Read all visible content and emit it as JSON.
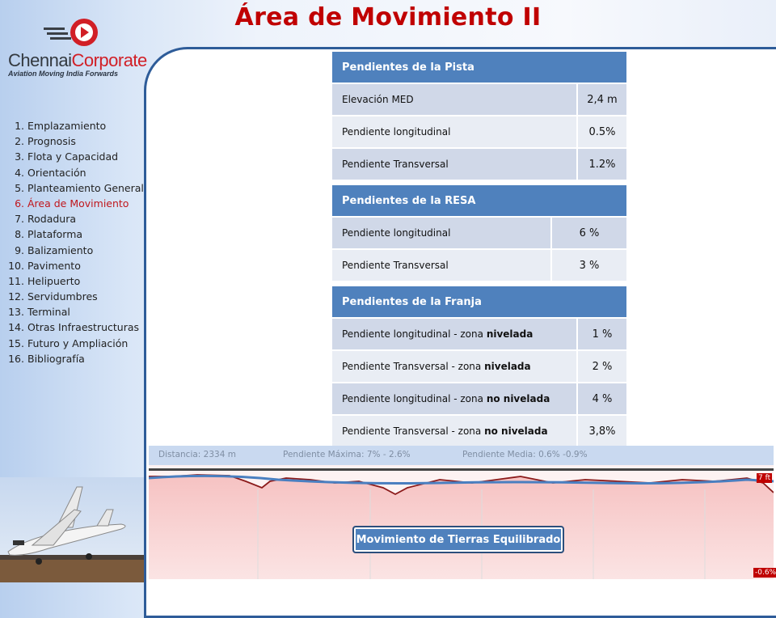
{
  "title": "Área de Movimiento II",
  "logo": {
    "name_dark": "Chennai",
    "name_red": "Corporate",
    "tagline": "Aviation Moving India Forwards"
  },
  "nav": [
    {
      "num": "1.",
      "label": "Emplazamiento"
    },
    {
      "num": "2.",
      "label": "Prognosis"
    },
    {
      "num": "3.",
      "label": "Flota y Capacidad"
    },
    {
      "num": "4.",
      "label": "Orientación"
    },
    {
      "num": "5.",
      "label": "Planteamiento General"
    },
    {
      "num": "6.",
      "label": "Área de Movimiento"
    },
    {
      "num": "7.",
      "label": "Rodadura"
    },
    {
      "num": "8.",
      "label": "Plataforma"
    },
    {
      "num": "9.",
      "label": "Balizamiento"
    },
    {
      "num": "10.",
      "label": "Pavimento"
    },
    {
      "num": "11.",
      "label": "Helipuerto"
    },
    {
      "num": "12.",
      "label": "Servidumbres"
    },
    {
      "num": "13.",
      "label": "Terminal"
    },
    {
      "num": "14.",
      "label": "Otras Infraestructuras"
    },
    {
      "num": "15.",
      "label": "Futuro y Ampliación"
    },
    {
      "num": "16.",
      "label": "Bibliografía"
    }
  ],
  "nav_active_index": 5,
  "table_pista": {
    "header": "Pendientes de la Pista",
    "rows": [
      {
        "label": "Elevación MED",
        "value": "2,4 m"
      },
      {
        "label": "Pendiente longitudinal",
        "value": "0.5%"
      },
      {
        "label": "Pendiente Transversal",
        "value": "1.2%"
      }
    ]
  },
  "table_resa": {
    "header": "Pendientes de la RESA",
    "rows": [
      {
        "label": "Pendiente longitudinal",
        "value": "6 %"
      },
      {
        "label": "Pendiente Transversal",
        "value": "3 %"
      }
    ]
  },
  "table_franja": {
    "header": "Pendientes de la Franja",
    "rows": [
      {
        "label_pre": "Pendiente longitudinal - zona ",
        "label_bold": "nivelada",
        "value": "1 %"
      },
      {
        "label_pre": "Pendiente Transversal - zona ",
        "label_bold": "nivelada",
        "value": "2 %"
      },
      {
        "label_pre": "Pendiente longitudinal - zona ",
        "label_bold": "no nivelada",
        "value": "4 %"
      },
      {
        "label_pre": "Pendiente Transversal - zona ",
        "label_bold": "no nivelada",
        "value": "3,8%"
      }
    ]
  },
  "profile": {
    "distancia": "Distancia: 2334 m",
    "pend_max": "Pendiente Máxima: 7% - 2.6%",
    "pend_media": "Pendiente Media: 0.6% -0.9%",
    "tag_top": "7 ft",
    "tag_bottom": "-0.6%",
    "button": "Movimiento de Tierras Equilibrado"
  },
  "colors": {
    "accent": "#4f81bd",
    "title": "#c00000",
    "border": "#2e5c99"
  }
}
